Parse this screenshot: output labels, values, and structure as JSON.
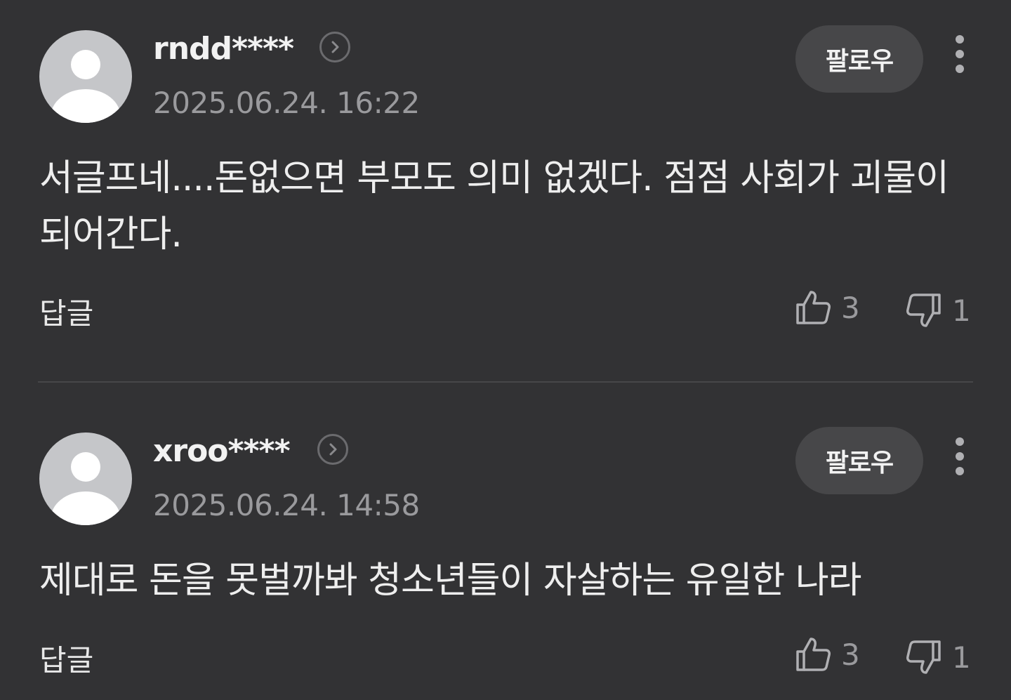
{
  "comments": [
    {
      "username": "rndd****",
      "timestamp": "2025.06.24. 16:22",
      "follow_label": "팔로우",
      "text": "서글프네....돈없으면 부모도 의미 없겠다. 점점 사회가 괴물이 되어간다.",
      "reply_label": "답글",
      "likes": "3",
      "dislikes": "1"
    },
    {
      "username": "xroo****",
      "timestamp": "2025.06.24. 14:58",
      "follow_label": "팔로우",
      "text": "제대로 돈을 못벌까봐 청소년들이 자살하는 유일한 나라",
      "reply_label": "답글",
      "likes": "3",
      "dislikes": "1"
    }
  ],
  "icons": {
    "avatar": "default-avatar-icon",
    "profile_link": "chevron-right-circle-icon",
    "more": "more-vertical-icon",
    "like": "thumbs-up-icon",
    "dislike": "thumbs-down-icon"
  }
}
